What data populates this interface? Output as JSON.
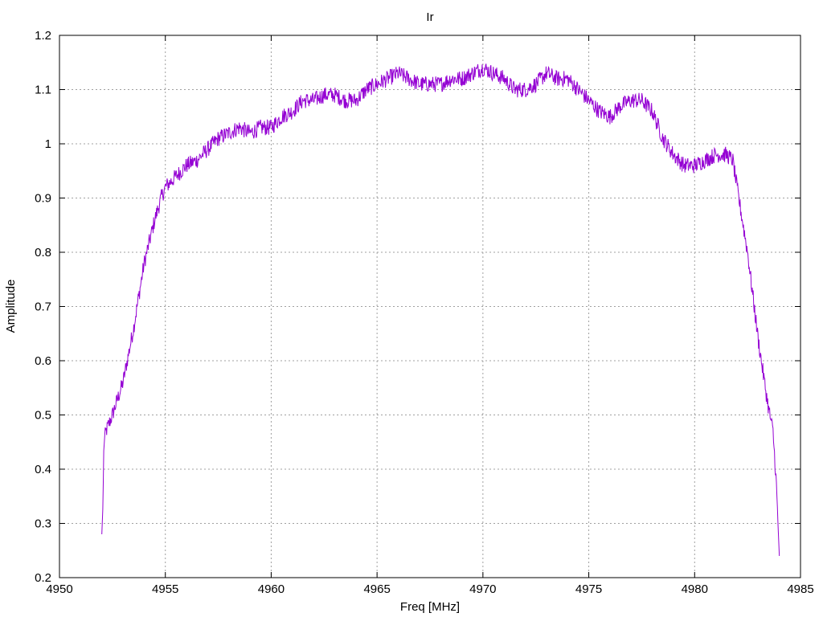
{
  "chart_data": {
    "type": "line",
    "title": "Ir",
    "xlabel": "Freq [MHz]",
    "ylabel": "Amplitude",
    "xlim": [
      4950,
      4985
    ],
    "ylim": [
      0.2,
      1.2
    ],
    "xticks": [
      4950,
      4955,
      4960,
      4965,
      4970,
      4975,
      4980,
      4985
    ],
    "xtick_labels": [
      "4950",
      "4955",
      "4960",
      "4965",
      "4970",
      "4975",
      "4980",
      "4985"
    ],
    "yticks": [
      0.2,
      0.3,
      0.4,
      0.5,
      0.6,
      0.7,
      0.8,
      0.9,
      1.0,
      1.1,
      1.2
    ],
    "ytick_labels": [
      "0.2",
      "0.3",
      "0.4",
      "0.5",
      "0.6",
      "0.7",
      "0.8",
      "0.9",
      "1",
      "1.1",
      "1.2"
    ],
    "grid": true,
    "legend": false,
    "line_color": "#9400d3",
    "series": [
      {
        "x": [
          4952.0,
          4952.05,
          4952.1,
          4952.2,
          4952.5,
          4953.0,
          4953.5,
          4954.0,
          4954.5,
          4954.8,
          4955.0,
          4955.5,
          4956.0,
          4956.5,
          4957.0,
          4957.5,
          4958.0,
          4958.5,
          4959.0,
          4959.5,
          4960.0,
          4960.5,
          4961.0,
          4961.5,
          4962.0,
          4962.5,
          4963.0,
          4963.5,
          4964.0,
          4964.5,
          4965.0,
          4965.5,
          4966.0,
          4966.5,
          4967.0,
          4967.5,
          4968.0,
          4968.5,
          4969.0,
          4969.5,
          4970.0,
          4970.5,
          4971.0,
          4971.5,
          4972.0,
          4972.5,
          4973.0,
          4973.5,
          4974.0,
          4974.5,
          4975.0,
          4975.5,
          4976.0,
          4976.5,
          4977.0,
          4977.5,
          4978.0,
          4978.5,
          4979.0,
          4979.5,
          4980.0,
          4980.5,
          4981.0,
          4981.5,
          4981.8,
          4982.0,
          4982.5,
          4983.0,
          4983.3,
          4983.5,
          4983.7,
          4983.85,
          4984.0
        ],
        "y": [
          0.28,
          0.33,
          0.45,
          0.47,
          0.5,
          0.56,
          0.66,
          0.78,
          0.86,
          0.9,
          0.92,
          0.94,
          0.96,
          0.97,
          0.99,
          1.01,
          1.02,
          1.03,
          1.02,
          1.03,
          1.03,
          1.05,
          1.06,
          1.08,
          1.08,
          1.09,
          1.09,
          1.08,
          1.08,
          1.1,
          1.11,
          1.12,
          1.13,
          1.12,
          1.11,
          1.11,
          1.11,
          1.12,
          1.12,
          1.13,
          1.14,
          1.13,
          1.12,
          1.1,
          1.1,
          1.11,
          1.13,
          1.12,
          1.12,
          1.1,
          1.08,
          1.06,
          1.05,
          1.07,
          1.08,
          1.08,
          1.06,
          1.01,
          0.98,
          0.96,
          0.96,
          0.97,
          0.98,
          0.98,
          0.97,
          0.92,
          0.8,
          0.64,
          0.56,
          0.51,
          0.47,
          0.38,
          0.24
        ]
      }
    ]
  }
}
